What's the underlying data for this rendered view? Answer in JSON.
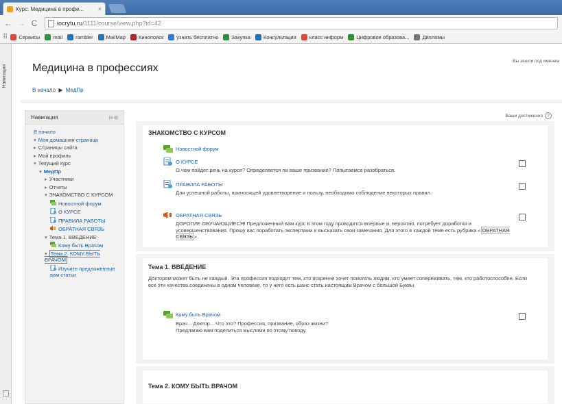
{
  "browser": {
    "tab_title": "Курс: Медицина в профе...",
    "tab_close": "×",
    "url_host": "iocrytu.ru",
    "url_path": "/1111/course/view.php?id=42",
    "bookmarks": [
      {
        "label": "Сервисы",
        "color": "#d94a38"
      },
      {
        "label": "mail",
        "color": "#2f8f3a"
      },
      {
        "label": "rambler",
        "color": "#2f6fb5"
      },
      {
        "label": "MailMap",
        "color": "#2f6fb5"
      },
      {
        "label": "Кинопоиск",
        "color": "#a62a2a"
      },
      {
        "label": "узнать бесплатно",
        "color": "#3a7bd5"
      },
      {
        "label": "Закупка",
        "color": "#2f8f3a"
      },
      {
        "label": "Консультации",
        "color": "#2f6fb5"
      },
      {
        "label": "класс информ",
        "color": "#d94a38"
      },
      {
        "label": "Цифровое образова...",
        "color": "#2f8f3a"
      },
      {
        "label": "Дипломы",
        "color": "#777777"
      }
    ]
  },
  "side_tab_label": "Навигация",
  "course": {
    "title": "Медицина в профессиях",
    "login_info": "Вы зашли под именем",
    "breadcrumb": [
      "В начало",
      "МедПр"
    ],
    "breadcrumb_sep": "▶"
  },
  "nav": {
    "title": "Навигация",
    "controls": "⊟ ⊞",
    "items": [
      {
        "label": "В начало",
        "arrow": "",
        "indent": 0,
        "link": true,
        "icon": ""
      },
      {
        "label": "Моя домашняя страница",
        "arrow": "▾",
        "indent": 0,
        "link": true,
        "icon": ""
      },
      {
        "label": "Страницы сайта",
        "arrow": "▸",
        "indent": 0,
        "link": false,
        "icon": ""
      },
      {
        "label": "Мой профиль",
        "arrow": "▸",
        "indent": 0,
        "link": false,
        "icon": ""
      },
      {
        "label": "Текущий курс",
        "arrow": "▾",
        "indent": 0,
        "link": false,
        "icon": ""
      },
      {
        "label": "МедПр",
        "arrow": "▾",
        "indent": 1,
        "link": true,
        "icon": "",
        "bold": true
      },
      {
        "label": "Участники",
        "arrow": "▸",
        "indent": 2,
        "link": false,
        "icon": ""
      },
      {
        "label": "Отчеты",
        "arrow": "▸",
        "indent": 2,
        "link": false,
        "icon": ""
      },
      {
        "label": "ЗНАКОМСТВО С КУРСОМ",
        "arrow": "▾",
        "indent": 2,
        "link": false,
        "icon": ""
      },
      {
        "label": "Новостной форум",
        "arrow": "",
        "indent": 3,
        "link": true,
        "icon": "forum"
      },
      {
        "label": "О КУРСЕ",
        "arrow": "",
        "indent": 3,
        "link": true,
        "icon": "page"
      },
      {
        "label": "ПРАВИЛА РАБОТЫ",
        "arrow": "",
        "indent": 3,
        "link": true,
        "icon": "page"
      },
      {
        "label": "ОБРАТНАЯ СВЯЗЬ",
        "arrow": "",
        "indent": 3,
        "link": true,
        "icon": "feedback"
      },
      {
        "label": "Тема 1. ВВЕДЕНИЕ",
        "arrow": "▾",
        "indent": 2,
        "link": false,
        "icon": ""
      },
      {
        "label": "Кому быть Врачом",
        "arrow": "",
        "indent": 3,
        "link": true,
        "icon": "forum"
      },
      {
        "label": "Тема 2. КОМУ БЫТЬ ВРАЧОМ",
        "arrow": "▾",
        "indent": 2,
        "link": true,
        "icon": "",
        "selected": true
      },
      {
        "label": "Изучите предложенные вам статьи",
        "arrow": "",
        "indent": 3,
        "link": true,
        "icon": "page"
      }
    ]
  },
  "main": {
    "additional_info": "Ваши достижения",
    "help": "?",
    "intro": {
      "title": "ЗНАКОМСТВО С КУРСОМ",
      "activities": [
        {
          "name": "Новостной форум",
          "icon": "forum",
          "desc": "",
          "checkbox": false
        },
        {
          "name": "О КУРСЕ",
          "icon": "page",
          "desc": "О чем пойдет речь на курсе? Определяется ли ваше призвание? Попытаемся разобраться.",
          "checkbox": true
        },
        {
          "name": "ПРАВИЛА РАБОТЫ",
          "icon": "page",
          "desc": "Для успешной работы, приносящей удовлетворение и пользу, необходимо соблюдение некоторых правил.",
          "checkbox": true
        },
        {
          "name": "ОБРАТНАЯ СВЯЗЬ",
          "icon": "feedback",
          "desc_pre": "ДОРОГИЕ ОБУЧАЮЩИЕСЯ! Предложенный вам курс в этом году проводится впервые и, вероятно, потребует доработки и усовершенствования. Прошу вас поработать экспертами и высказать свои замечания. Для этого в каждой теме есть рубрика «",
          "desc_hl": "ОБРАТНАЯ СВЯЗЬ",
          "desc_post": "».",
          "checkbox": true
        }
      ]
    },
    "topic1": {
      "title": "Тема 1. ВВЕДЕНИЕ",
      "summary": "Доктором может быть не каждый. Эта профессия подходит тем, кто искренне хочет помогать людям, кто умеет сопереживать, тем, кто работоспособен. Если все эти качества соединены в одном человеке, то у него есть шанс стать настоящим Врачом с большой Буквы.",
      "activity": {
        "name": "Кому быть Врачом",
        "icon": "forum",
        "desc1": "Врач... Доктор... Что это? Профессия, призвание, образ жизни?",
        "desc2": "Предлагаю вам поделиться мыслями по этому поводу."
      }
    },
    "topic2": {
      "title": "Тема 2. КОМУ БЫТЬ ВРАЧОМ"
    }
  },
  "colors": {
    "link": "#1a5ea8",
    "chrome": "#4f7fb5"
  }
}
